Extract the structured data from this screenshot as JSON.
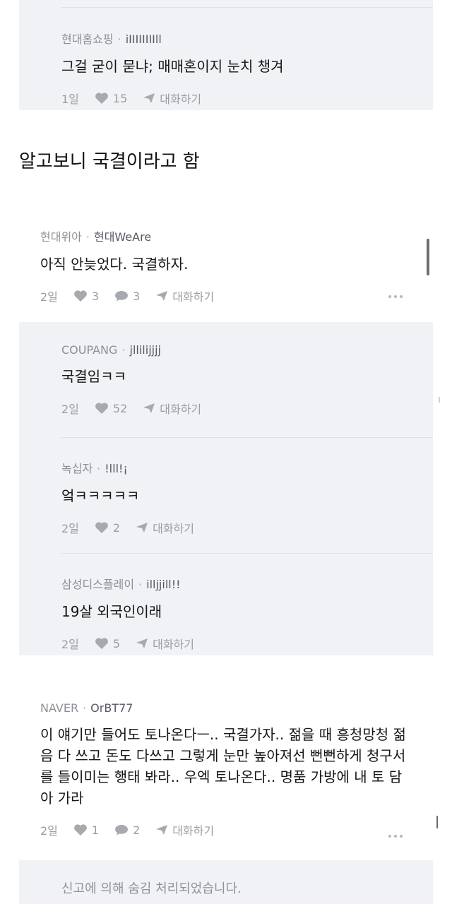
{
  "comments": {
    "c1": {
      "company": "현대홈쇼핑",
      "handle": "iIIIIIIIIll",
      "text": "그걸 굳이 묻냐; 매매혼이지 눈치 챙겨",
      "time": "1일",
      "likes": "15",
      "reply": "대화하기"
    },
    "heading": "알고보니 국결이라고 함",
    "c2": {
      "company": "현대위아",
      "handle": "현대WeAre",
      "text": "아직 안늦었다. 국결하자.",
      "time": "2일",
      "likes": "3",
      "comments": "3",
      "reply": "대화하기"
    },
    "r1": {
      "company": "COUPANG",
      "handle": "jllilijjjj",
      "text": "국결임ㅋㅋ",
      "time": "2일",
      "likes": "52",
      "reply": "대화하기"
    },
    "r2": {
      "company": "녹십자",
      "handle": "!lll!¡",
      "text": "엌ㅋㅋㅋㅋㅋ",
      "time": "2일",
      "likes": "2",
      "reply": "대화하기"
    },
    "r3": {
      "company": "삼성디스플레이",
      "handle": "illjjill!!",
      "text": "19살 외국인이래",
      "time": "2일",
      "likes": "5",
      "reply": "대화하기"
    },
    "c3": {
      "company": "NAVER",
      "handle": "OrBT77",
      "text": "이 얘기만 들어도 토나온다ㅡ.. 국결가자.. 젊을 때 흥청망청 젊음 다 쓰고 돈도 다쓰고 그렇게 눈만 높아져선 뻔뻔하게 청구서를 들이미는 행태 봐라.. 우엑 토나온다.. 명품 가방에 내 토 담아 가라",
      "time": "2일",
      "likes": "1",
      "comments": "2",
      "reply": "대화하기"
    },
    "hidden": "신고에 의해 숨김 처리되었습니다."
  },
  "colors": {
    "reply_bg": "#f1f2f5",
    "meta_text": "#8c8f96",
    "icon": "#a6a9ae"
  },
  "icons": {
    "like": "heart-icon",
    "comment": "speech-bubble-icon",
    "reply": "paper-plane-icon",
    "more": "more-dots-icon"
  }
}
